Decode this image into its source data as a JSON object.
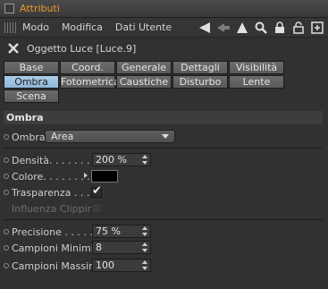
{
  "window": {
    "title": "Attributi"
  },
  "menu": {
    "items": [
      "Modo",
      "Modifica",
      "Dati Utente"
    ]
  },
  "toolbar": {
    "icons": [
      "arrow-left-icon",
      "arrow-back-grey-icon",
      "arrow-up-icon",
      "search-icon",
      "lock-icon",
      "padlock-icon",
      "new-panel-icon"
    ]
  },
  "object": {
    "title": "Oggetto Luce [Luce.9]"
  },
  "tabs": {
    "row1": [
      "Base",
      "Coord.",
      "Generale",
      "Dettagli",
      "Visibilità"
    ],
    "row2": [
      "Ombra",
      "Fotometrica",
      "Caustiche",
      "Disturbo",
      "Lente"
    ],
    "row3": [
      "Scena"
    ],
    "active": "Ombra"
  },
  "section": {
    "title": "Ombra",
    "shadow": {
      "label": "Ombra",
      "value": "Area"
    },
    "density": {
      "label": "Densità. . . . . . . . ",
      "value": "200 %"
    },
    "color": {
      "label": "Colore. . . . . . . . . ",
      "value_hex": "#000000"
    },
    "transparency": {
      "label": "Trasparenza . . . . ",
      "checked": true
    },
    "clipping": {
      "label": "Influenza Clipping",
      "enabled": false
    },
    "precision": {
      "label": "Precisione . . . . . ",
      "value": "75 %"
    },
    "min_samples": {
      "label": "Campioni Minimi",
      "value": "8"
    },
    "max_samples": {
      "label": "Campioni Massimi",
      "value": "100"
    }
  },
  "colors": {
    "title_accent": "#e89a2e",
    "active_tab": "#9fc3e3"
  }
}
